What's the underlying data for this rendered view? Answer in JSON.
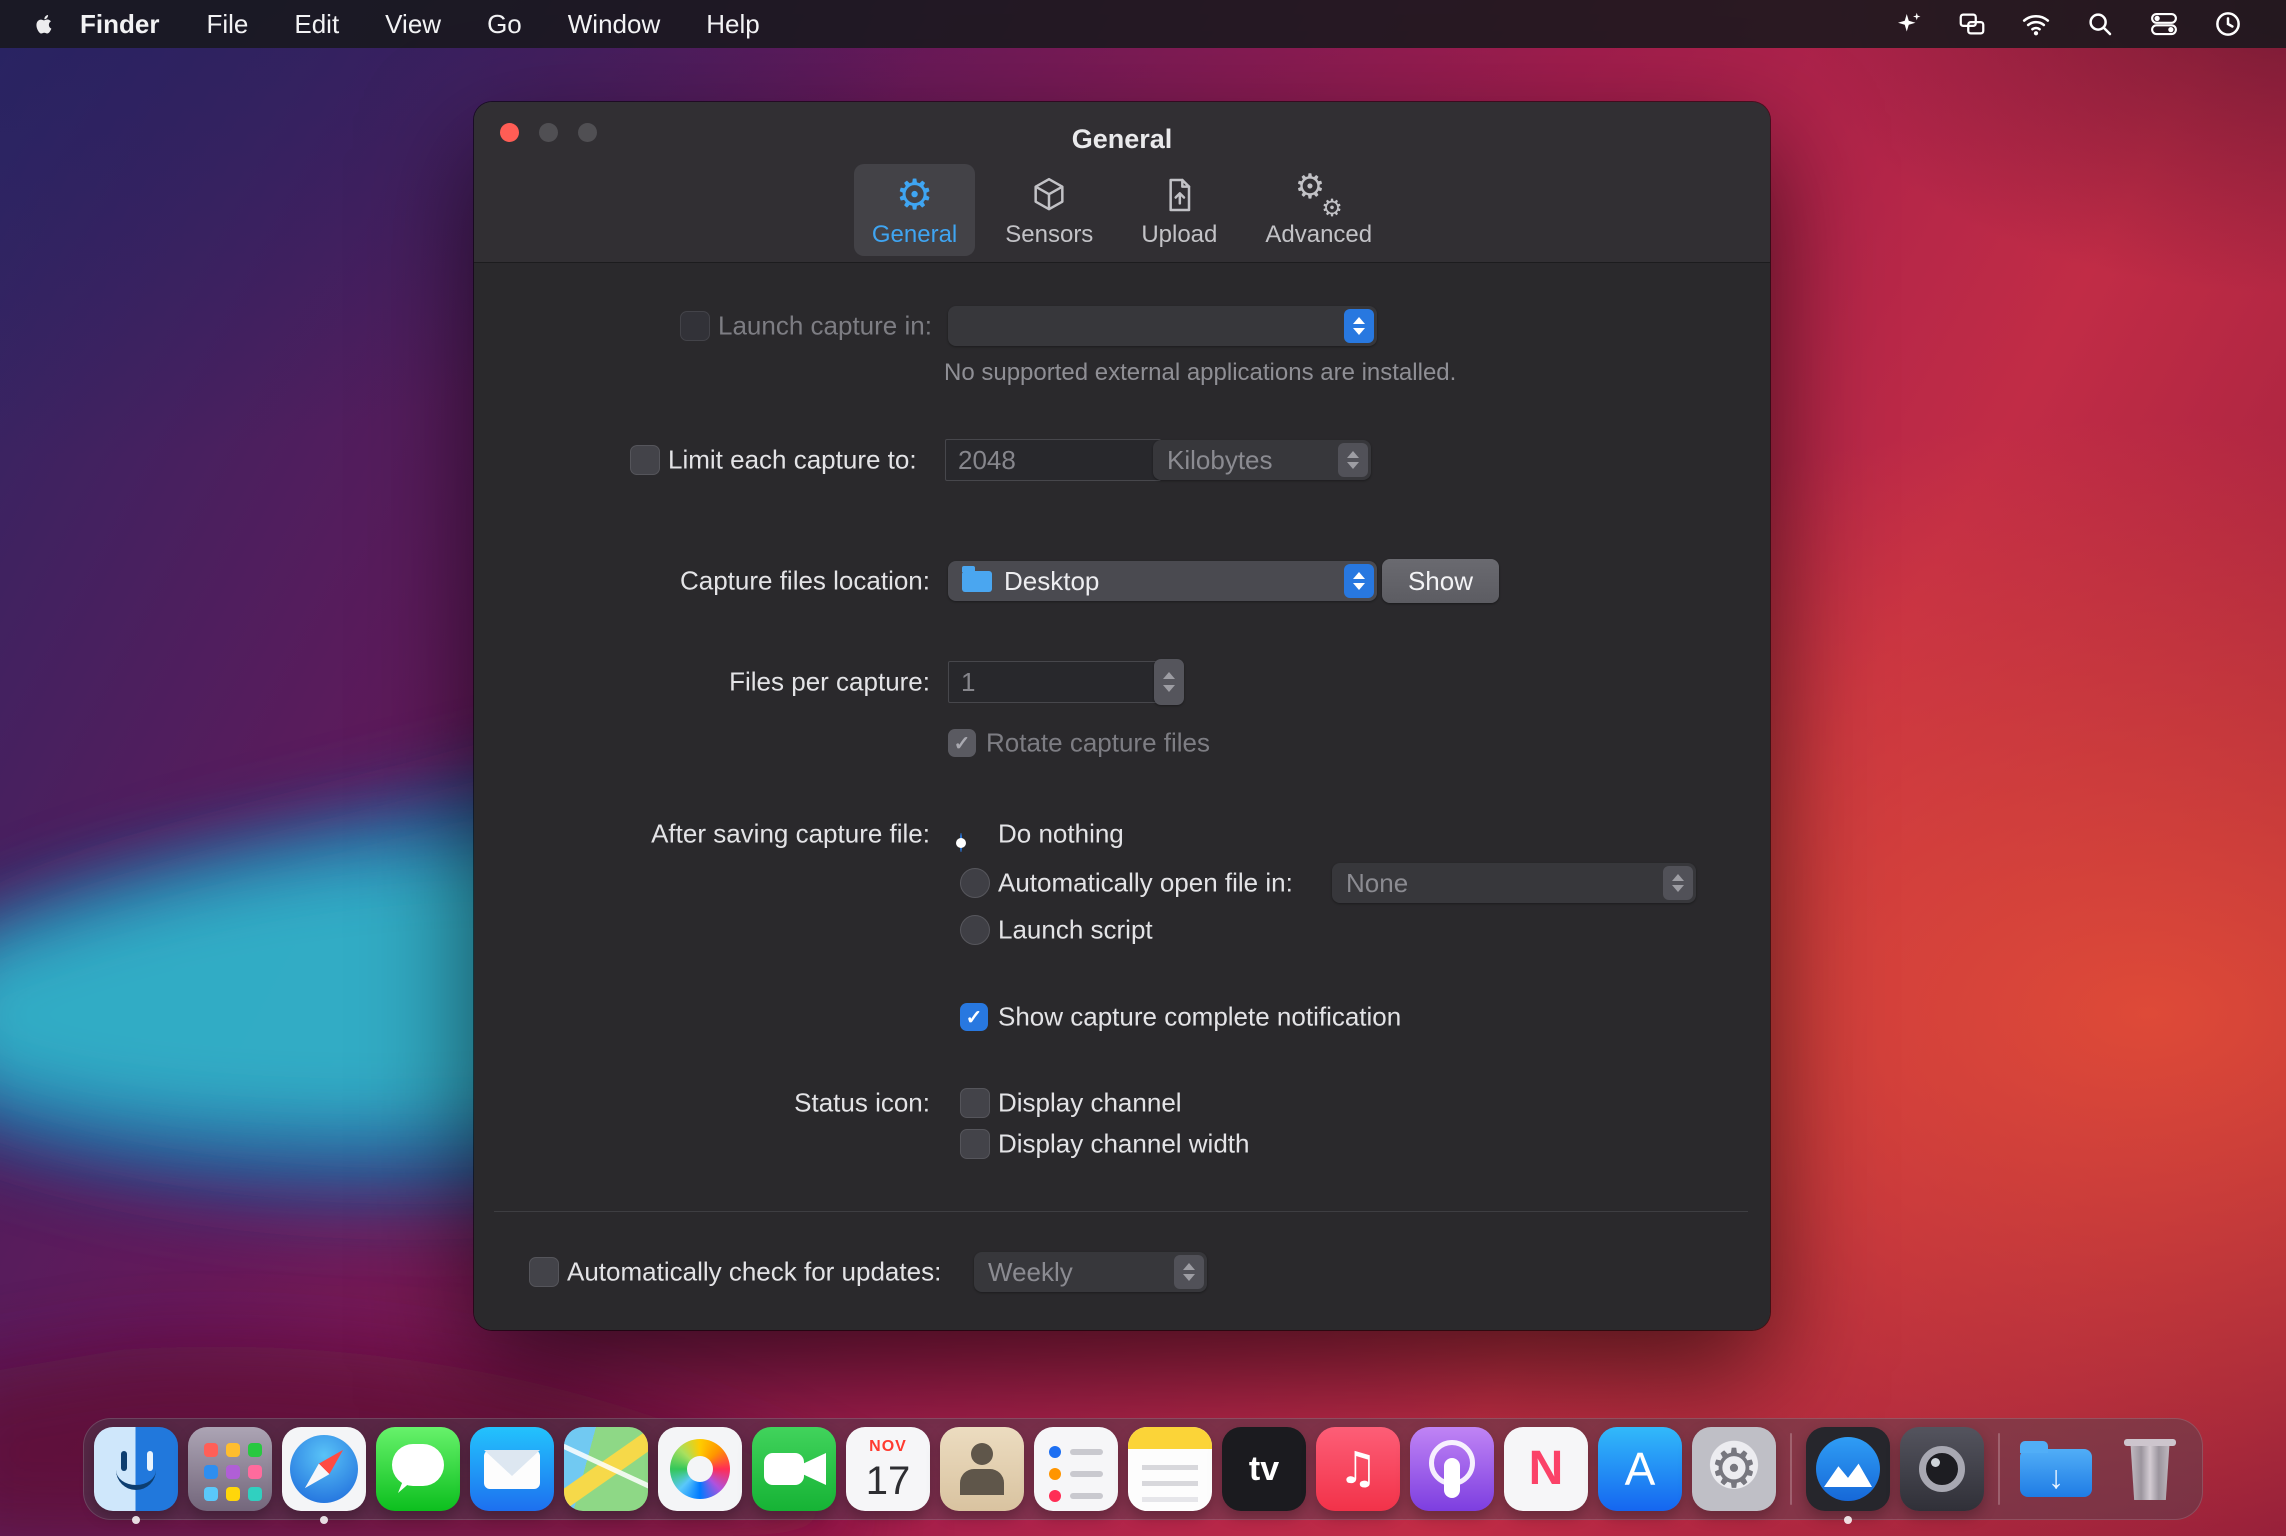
{
  "menu_bar": {
    "app_name": "Finder",
    "items": [
      "File",
      "Edit",
      "View",
      "Go",
      "Window",
      "Help"
    ],
    "status_icons": [
      "sparkle-icon",
      "windows-icon",
      "wifi-icon",
      "search-icon",
      "control-center-icon",
      "clock-icon"
    ]
  },
  "window": {
    "title": "General",
    "tabs": [
      {
        "label": "General",
        "active": true
      },
      {
        "label": "Sensors",
        "active": false
      },
      {
        "label": "Upload",
        "active": false
      },
      {
        "label": "Advanced",
        "active": false
      }
    ],
    "rows": {
      "launch_capture": {
        "label": "Launch capture in:",
        "value": "",
        "checked": false,
        "note": "No supported external applications are installed."
      },
      "limit_capture": {
        "label": "Limit each capture to:",
        "size_value": "2048",
        "unit_value": "Kilobytes",
        "checked": false
      },
      "location": {
        "label": "Capture files location:",
        "value": "Desktop",
        "button": "Show"
      },
      "files_per_capture": {
        "label": "Files per capture:",
        "value": "1"
      },
      "rotate": {
        "label": "Rotate capture files",
        "checked": true
      },
      "after_saving": {
        "label": "After saving capture file:",
        "radio_do_nothing": "Do nothing",
        "radio_open_in": "Automatically open file in:",
        "open_in_value": "None",
        "radio_launch_script": "Launch script",
        "selected": "Do nothing"
      },
      "notification": {
        "label": "Show capture complete notification",
        "checked": true
      },
      "status_icon": {
        "label": "Status icon:",
        "option1": "Display channel",
        "option2": "Display channel width",
        "option1_checked": false,
        "option2_checked": false
      },
      "updates": {
        "label": "Automatically check for updates:",
        "value": "Weekly",
        "checked": false
      }
    }
  },
  "dock": {
    "items": [
      {
        "name": "finder",
        "running": true
      },
      {
        "name": "launchpad",
        "running": false
      },
      {
        "name": "safari",
        "running": true
      },
      {
        "name": "messages",
        "running": false
      },
      {
        "name": "mail",
        "running": false
      },
      {
        "name": "maps",
        "running": false
      },
      {
        "name": "photos",
        "running": false
      },
      {
        "name": "facetime",
        "running": false
      },
      {
        "name": "calendar",
        "running": false,
        "text1": "NOV",
        "text2": "17"
      },
      {
        "name": "contacts",
        "running": false
      },
      {
        "name": "reminders",
        "running": false
      },
      {
        "name": "notes",
        "running": false
      },
      {
        "name": "appletv",
        "running": false,
        "text1": "tv"
      },
      {
        "name": "music",
        "running": false,
        "text1": "♫"
      },
      {
        "name": "podcasts",
        "running": false
      },
      {
        "name": "news",
        "running": false,
        "text1": "N"
      },
      {
        "name": "appstore",
        "running": false,
        "text1": "A"
      },
      {
        "name": "systemprefs",
        "running": false,
        "text1": "⚙"
      },
      {
        "name": "divider"
      },
      {
        "name": "airtool",
        "running": true
      },
      {
        "name": "camera-app",
        "running": false
      },
      {
        "name": "divider"
      },
      {
        "name": "downloads",
        "running": false,
        "text1": "↓"
      },
      {
        "name": "trash",
        "running": false
      }
    ]
  },
  "colors": {
    "accent_blue": "#2878e0",
    "tab_active_blue": "#3fa5f2",
    "close_button_red": "#ff5d55",
    "window_bg": "#2a292c"
  }
}
